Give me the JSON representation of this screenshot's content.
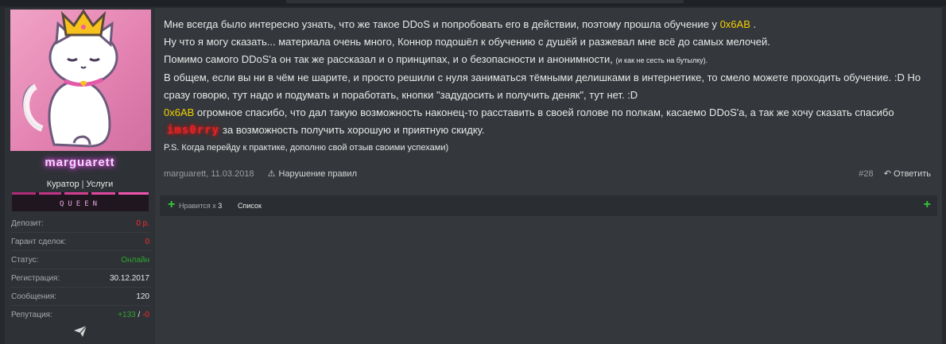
{
  "user": {
    "username": "marguarett",
    "title_left": "Куратор",
    "title_sep": "|",
    "title_right": "Услуги",
    "banner_text": "QUEEN",
    "stats": [
      {
        "label": "Депозит:",
        "value": "0 р."
      },
      {
        "label": "Гарант сделок:",
        "value": "0"
      },
      {
        "label": "Статус:",
        "value": "Онлайн"
      },
      {
        "label": "Регистрация:",
        "value": "30.12.2017"
      },
      {
        "label": "Сообщения:",
        "value": "120"
      },
      {
        "label": "Репутация:",
        "value_pos": "+133",
        "value_sep": "/",
        "value_neg": "-0"
      }
    ]
  },
  "post": {
    "line1_before": "Мне всегда было интересно узнать, что же такое DDoS и попробовать его в действии, поэтому прошла обучение у ",
    "line1_hl": "0x6AB",
    "line1_after": " .",
    "line2": "Ну что я могу сказать... материала очень много, Коннор подошёл к обучению с душёй и разжевал мне всё до самых мелочей.",
    "line3": "Помимо самого DDoS'а он так же рассказал и о принципах, и о безопасности и анонимности, ",
    "line3_small": "(и как не сесть на бутылку).",
    "line4": "В общем, если вы ни в чём не шарите, и просто решили с нуля заниматься тёмными делишками в интернетике, то смело можете проходить обучение. :D Но сразу говорю, тут надо и подумать и поработать, кнопки \"задудосить и получить деняк\", тут нет. :D",
    "line5_hl": "0x6AB",
    "line5_text": " огромное спасибо, что дал такую возможность наконец-то расставить в своей голове по полкам, касаемо DDoS'а, а так же хочу сказать спасибо",
    "line5_glitch": "ims0rry",
    "line5_end": "за возможность получить хорошую и приятную скидку.",
    "ps": "P.S. Когда перейду к практике, дополню свой отзыв своими успехами)",
    "meta_author": "marguarett,",
    "meta_date": "11.03.2018",
    "report": "Нарушение правил",
    "post_number": "#28",
    "reply": "Ответить"
  },
  "likes": {
    "text": "Нравится х",
    "count": "3",
    "list": "Список"
  },
  "colors": {
    "highlight": "#f5d000",
    "negative": "#ff2a2a",
    "online": "#2fa52f",
    "glow": "#ff4fd8"
  }
}
